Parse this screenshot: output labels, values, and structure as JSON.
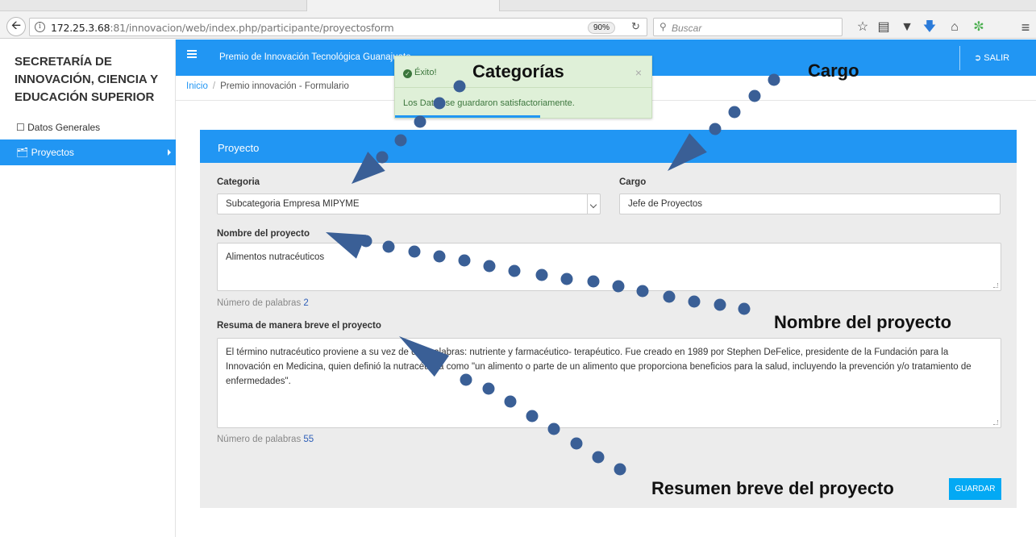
{
  "browser": {
    "url_host": "172.25.3.68",
    "url_rest": ":81/innovacion/web/index.php/participante/proyectosform",
    "zoom": "90%",
    "search_placeholder": "Buscar"
  },
  "sidebar": {
    "brand": "SECRETARÍA DE INNOVACIÓN, CIENCIA Y EDUCACIÓN SUPERIOR",
    "items": [
      {
        "label": "Datos Generales",
        "icon": "square-icon",
        "active": false
      },
      {
        "label": "Proyectos",
        "icon": "folder-open-icon",
        "active": true
      }
    ]
  },
  "app_bar": {
    "title": "Premio de Innovación Tecnológica Guanajuato",
    "logout": "SALIR"
  },
  "breadcrumb": {
    "home": "Inicio",
    "current": "Premio innovación - Formulario"
  },
  "toast": {
    "title": "Éxito!",
    "message": "Los Datos se guardaron satisfactoriamente."
  },
  "form": {
    "card_title": "Proyecto",
    "categoria_label": "Categoria",
    "categoria_value": "Subcategoria Empresa MIPYME",
    "cargo_label": "Cargo",
    "cargo_value": "Jefe de Proyectos",
    "nombre_label": "Nombre del proyecto",
    "nombre_value": "Alimentos nutracéuticos",
    "nombre_count_label": "Número de palabras",
    "nombre_count": "2",
    "resumen_label": "Resuma de manera breve el proyecto",
    "resumen_value": "El término nutracéutico proviene a su vez de dos palabras: nutriente y farmacéutico- terapéutico. Fue creado en 1989 por Stephen DeFelice, presidente de la Fundación para la Innovación en Medicina, quien definió la nutracéutica como \"un alimento o parte de un alimento que proporciona beneficios para la salud, incluyendo la prevención y/o tratamiento de enfermedades\".",
    "resumen_count_label": "Número de palabras",
    "resumen_count": "55",
    "save_label": "GUARDAR"
  },
  "annotations": {
    "categorias": "Categorías",
    "cargo": "Cargo",
    "nombre": "Nombre del proyecto",
    "resumen": "Resumen breve del proyecto",
    "color": "#3a5f96"
  }
}
